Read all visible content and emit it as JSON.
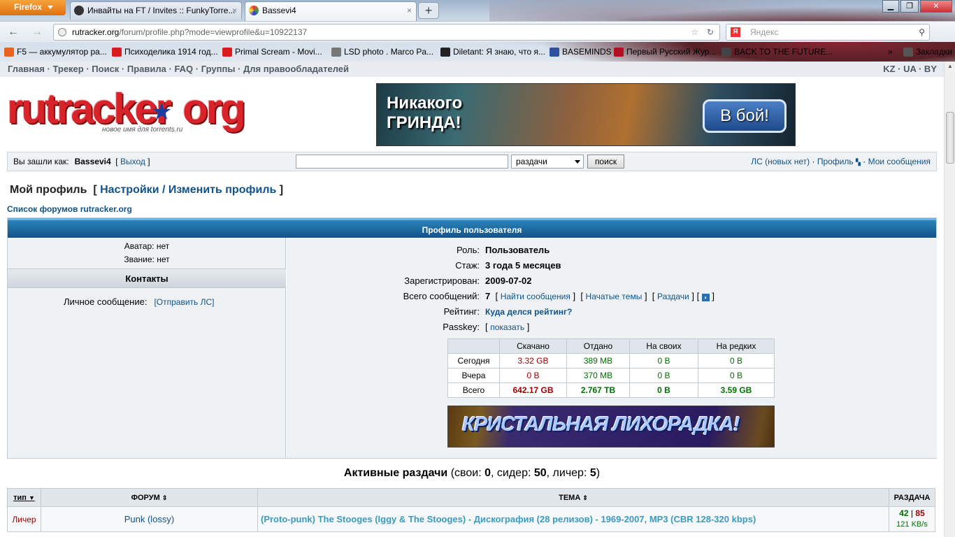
{
  "browser": {
    "menu_button": "Firefox",
    "tabs": [
      {
        "label": "Инвайты на FT / Invites :: FunkyTorre...",
        "close": "×"
      },
      {
        "label": "Bassevi4",
        "close": "×"
      }
    ],
    "new_tab": "+",
    "url_host": "rutracker.org",
    "url_path": "/forum/profile.php?mode=viewprofile&u=10922137",
    "search_placeholder": "Яндекс",
    "search_engine_icon": "Я",
    "bookmarks": [
      {
        "label": "F5 — аккумулятор ра...",
        "icon_color": "#e8641e"
      },
      {
        "label": "Психоделика 1914 год...",
        "icon_color": "#d91c1c"
      },
      {
        "label": "Primal Scream - Movi...",
        "icon_color": "#d91c1c"
      },
      {
        "label": "LSD photo . Marco Pa...",
        "icon_color": "#777777"
      },
      {
        "label": "Diletant: Я знаю, что я...",
        "icon_color": "#222222"
      },
      {
        "label": "BASEMINDS",
        "icon_color": "#3050a0"
      },
      {
        "label": "Первый Русский Жур...",
        "icon_color": "#b01020"
      },
      {
        "label": "BACK TO THE FUTURE...",
        "icon_color": "#444444"
      }
    ],
    "bookmarks_overflow": "»",
    "bookmarks_menu": "Закладки"
  },
  "site": {
    "topnav": [
      "Главная",
      "Трекер",
      "Поиск",
      "Правила",
      "FAQ",
      "Группы",
      "Для правообладателей"
    ],
    "topnav_sep": " · ",
    "langs": "KZ · UA · BY",
    "logo_text": "rutracker",
    "logo_tld": "org",
    "logo_sub": "новое имя для torrents.ru",
    "banner_top_text": "Никакого ГРИНДА!",
    "banner_top_button": "В бой!",
    "login_label": "Вы зашли как:",
    "username": "Bassevi4",
    "logout": "Выход",
    "search_select": "раздачи",
    "search_button": "поиск",
    "pm_link": "ЛС (новых нет)",
    "profile_link": "Профиль",
    "my_posts_link": "Мои сообщения"
  },
  "profile": {
    "title": "Мой профиль",
    "settings_link": "Настройки / Изменить профиль",
    "forum_list_link": "Список форумов rutracker.org",
    "header": "Профиль пользователя",
    "avatar": "Аватар: нет",
    "rank": "Звание: нет",
    "contacts_header": "Контакты",
    "pm_label": "Личное сообщение:",
    "pm_send": "[Отправить ЛС]",
    "role_k": "Роль:",
    "role_v": "Пользователь",
    "exp_k": "Стаж:",
    "exp_v": "3 года 5 месяцев",
    "reg_k": "Зарегистрирован:",
    "reg_v": "2009-07-02",
    "posts_k": "Всего сообщений:",
    "posts_v": "7",
    "find_posts": "Найти сообщения",
    "started_topics": "Начатые темы",
    "releases": "Раздачи",
    "rating_k": "Рейтинг:",
    "rating_v": "Куда делся рейтинг?",
    "passkey_k": "Passkey:",
    "passkey_v": "показать",
    "stats": {
      "headers": [
        "",
        "Скачано",
        "Отдано",
        "На своих",
        "На редких"
      ],
      "rows": [
        [
          "Сегодня",
          "3.32 GB",
          "389 MB",
          "0 B",
          "0 B"
        ],
        [
          "Вчера",
          "0 B",
          "370 MB",
          "0 B",
          "0 B"
        ],
        [
          "Всего",
          "642.17 GB",
          "2.767 TB",
          "0 B",
          "3.59 GB"
        ]
      ]
    },
    "banner_bottom_text": "КРИСТАЛЬНАЯ ЛИХОРАДКА!"
  },
  "active": {
    "title": "Активные раздачи",
    "own_label": "свои:",
    "own": "0",
    "seeder_label": "сидер:",
    "seeder": "50",
    "leecher_label": "личер:",
    "leecher": "5",
    "columns": [
      "тип",
      "ФОРУМ",
      "ТЕМА",
      "РАЗДАЧА"
    ],
    "rows": [
      {
        "type": "Личер",
        "forum": "Punk (lossy)",
        "topic": "(Proto-punk) The Stooges (Iggy & The Stooges) - Дискография (28 релизов) - 1969-2007, MP3 (CBR 128-320 kbps)",
        "seeds": "42",
        "leech": "85",
        "speed": "121 KB/s"
      }
    ]
  }
}
